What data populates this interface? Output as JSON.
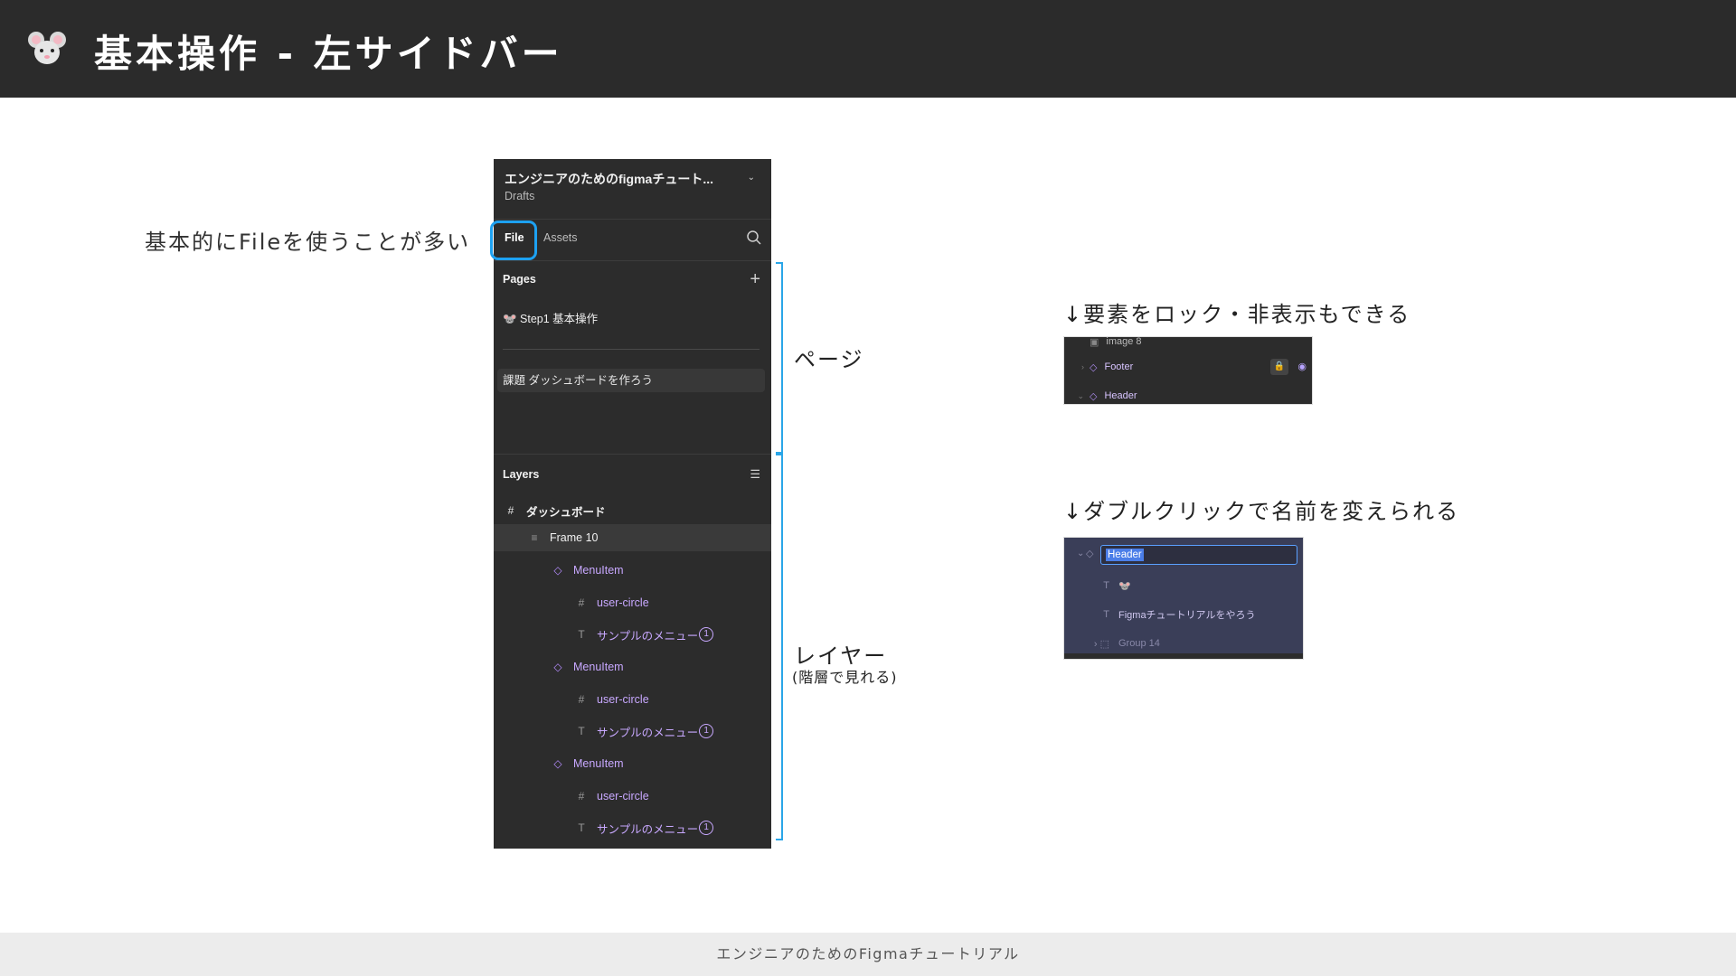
{
  "header": {
    "title": "基本操作 - 左サイドバー",
    "icon": "mouse-face-icon"
  },
  "footer": {
    "text": "エンジニアのためのFigmaチュートリアル"
  },
  "annotations": {
    "file_note": "基本的にFileを使うことが多い",
    "pages_note": "ページ",
    "layers_note": "レイヤー",
    "layers_sub": "(階層で見れる)",
    "lock_note": "↓要素をロック・非表示もできる",
    "rename_note": "↓ダブルクリックで名前を変えられる"
  },
  "colors": {
    "header_bg": "#2b2b2b",
    "panel_bg": "#2c2c2c",
    "accent_blue": "#2aa6e8",
    "component_purple": "#c8a8ff"
  },
  "panel": {
    "file_name": "エンジニアのためのfigmaチュート...",
    "file_location": "Drafts",
    "tabs": {
      "file": "File",
      "assets": "Assets"
    },
    "pages_label": "Pages",
    "pages": [
      "🐭 Step1 基本操作",
      "課題 ダッシュボードを作ろう"
    ],
    "layers_label": "Layers",
    "layers": [
      {
        "name": "ダッシュボード",
        "icon": "#"
      },
      {
        "name": "Frame 10",
        "icon": "≡"
      },
      {
        "name": "MenuItem",
        "icon": "◇"
      },
      {
        "name": "user-circle",
        "icon": "#"
      },
      {
        "name": "サンプルのメニュー",
        "icon": "T",
        "badge": "1"
      },
      {
        "name": "MenuItem",
        "icon": "◇"
      },
      {
        "name": "user-circle",
        "icon": "#"
      },
      {
        "name": "サンプルのメニュー",
        "icon": "T",
        "badge": "1"
      },
      {
        "name": "MenuItem",
        "icon": "◇"
      },
      {
        "name": "user-circle",
        "icon": "#"
      },
      {
        "name": "サンプルのメニュー",
        "icon": "T",
        "badge": "1"
      }
    ]
  },
  "lock_example": {
    "rows": [
      "image 8",
      "Footer",
      "Header"
    ]
  },
  "rename_example": {
    "editing": "Header",
    "rows": [
      "🐭",
      "Figmaチュートリアルをやろう",
      "Group 14"
    ]
  }
}
